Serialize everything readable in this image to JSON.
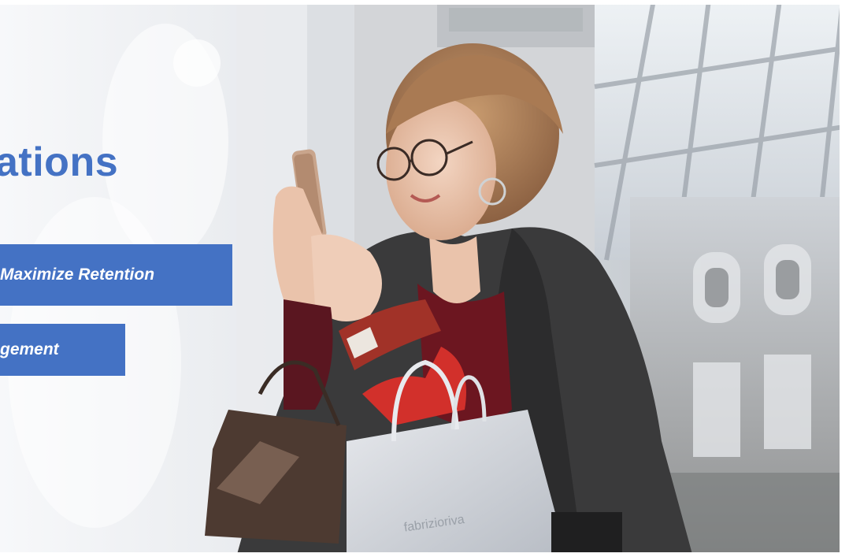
{
  "headline": "ations",
  "banners": [
    {
      "label": "Maximize Retention"
    },
    {
      "label": "gement"
    }
  ],
  "colors": {
    "accent": "#4472c4",
    "banner_text": "#ffffff"
  }
}
